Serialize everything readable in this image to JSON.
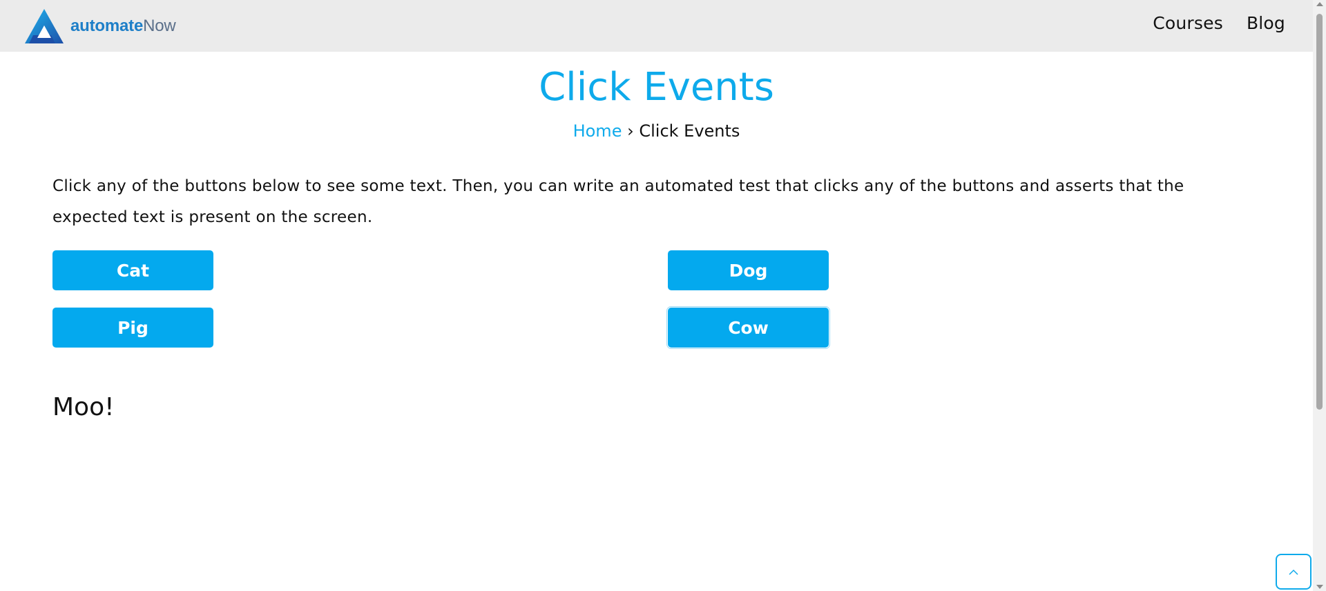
{
  "header": {
    "logo_bold": "automate",
    "logo_light": "Now",
    "nav": [
      "Courses",
      "Blog"
    ]
  },
  "page": {
    "title": "Click Events",
    "breadcrumb_home": "Home",
    "breadcrumb_sep": "›",
    "breadcrumb_current": "Click Events",
    "intro": "Click any of the buttons below to see some text. Then, you can write an automated test that clicks any of the buttons and asserts that the expected text is present on the screen."
  },
  "buttons": {
    "cat": "Cat",
    "dog": "Dog",
    "pig": "Pig",
    "cow": "Cow"
  },
  "result_text": "Moo!",
  "colors": {
    "accent": "#0eaaeb",
    "button": "#04a9ee",
    "header_bg": "#ebebeb"
  },
  "icons": {
    "logo": "automatenow-logo-icon",
    "back_to_top": "chevron-up-icon"
  }
}
